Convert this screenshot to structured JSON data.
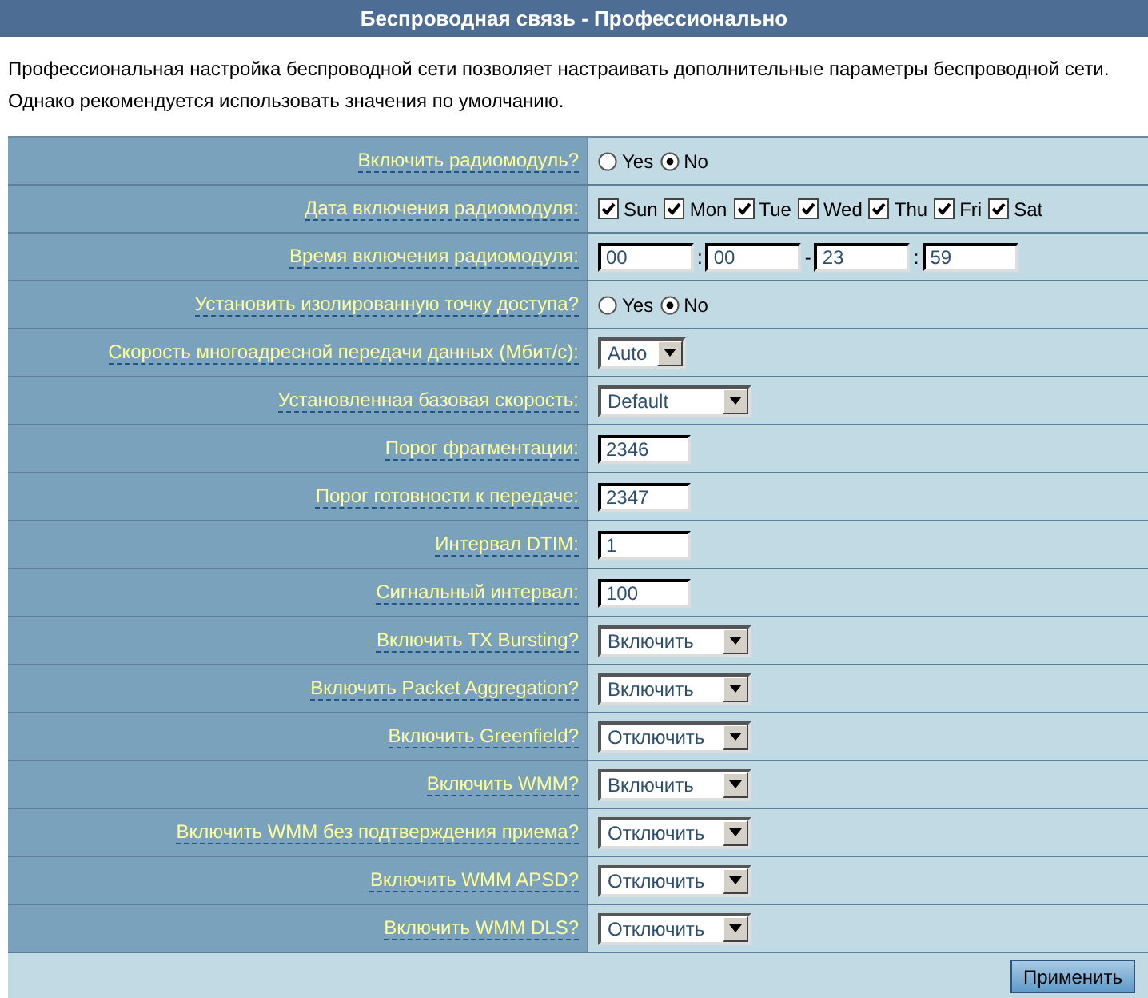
{
  "header": {
    "title": "Беспроводная связь - Профессионально"
  },
  "description": [
    "Профессиональная настройка беспроводной сети позволяет настраивать дополнительные параметры беспроводной сети.",
    "Однако рекомендуется использовать значения по умолчанию."
  ],
  "rows": [
    {
      "kind": "radio",
      "label": "Включить радиомодуль?",
      "options": [
        {
          "label": "Yes",
          "selected": false
        },
        {
          "label": "No",
          "selected": true
        }
      ]
    },
    {
      "kind": "checkboxes",
      "label": "Дата включения радиомодуля:",
      "options": [
        {
          "label": "Sun",
          "checked": true
        },
        {
          "label": "Mon",
          "checked": true
        },
        {
          "label": "Tue",
          "checked": true
        },
        {
          "label": "Wed",
          "checked": true
        },
        {
          "label": "Thu",
          "checked": true
        },
        {
          "label": "Fri",
          "checked": true
        },
        {
          "label": "Sat",
          "checked": true
        }
      ]
    },
    {
      "kind": "time",
      "label": "Время включения радиомодуля:",
      "parts": [
        {
          "kind": "field",
          "value": "00"
        },
        {
          "kind": "separator",
          "text": ":"
        },
        {
          "kind": "field",
          "value": "00"
        },
        {
          "kind": "separator",
          "text": "-"
        },
        {
          "kind": "field",
          "value": "23"
        },
        {
          "kind": "separator",
          "text": ":"
        },
        {
          "kind": "field",
          "value": "59"
        }
      ]
    },
    {
      "kind": "radio",
      "label": "Установить изолированную точку доступа?",
      "options": [
        {
          "label": "Yes",
          "selected": false
        },
        {
          "label": "No",
          "selected": true
        }
      ]
    },
    {
      "kind": "select",
      "label": "Скорость многоадресной передачи данных (Мбит/с):",
      "value": "Auto"
    },
    {
      "kind": "select",
      "label": "Установленная базовая скорость:",
      "value": "Default"
    },
    {
      "kind": "text",
      "label": "Порог фрагментации:",
      "value": "2346"
    },
    {
      "kind": "text",
      "label": "Порог готовности к передаче:",
      "value": "2347"
    },
    {
      "kind": "text",
      "label": "Интервал DTIM:",
      "value": "1"
    },
    {
      "kind": "text",
      "label": "Сигнальный интервал:",
      "value": "100"
    },
    {
      "kind": "select",
      "label": "Включить TX Bursting?",
      "value": "Включить"
    },
    {
      "kind": "select",
      "label": "Включить Packet Aggregation?",
      "value": "Включить"
    },
    {
      "kind": "select",
      "label": "Включить Greenfield?",
      "value": "Отключить"
    },
    {
      "kind": "select",
      "label": "Включить WMM?",
      "value": "Включить"
    },
    {
      "kind": "select",
      "label": "Включить WMM без подтверждения приема?",
      "value": "Отключить"
    },
    {
      "kind": "select",
      "label": "Включить WMM APSD?",
      "value": "Отключить"
    },
    {
      "kind": "select",
      "label": "Включить WMM DLS?",
      "value": "Отключить"
    }
  ],
  "apply_button": "Применить"
}
